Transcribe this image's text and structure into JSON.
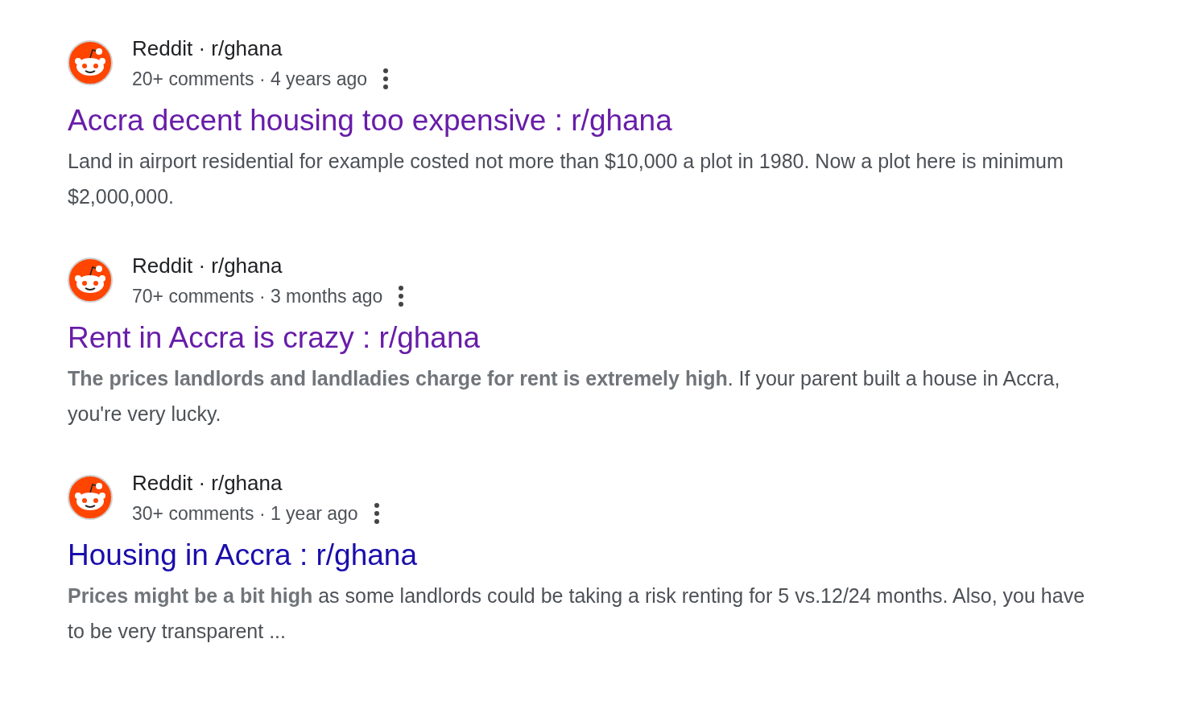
{
  "results": [
    {
      "source": "Reddit · r/ghana",
      "meta": "20+ comments · 4 years ago",
      "title": "Accra decent housing too expensive : r/ghana",
      "visited": true,
      "snippet": "Land in airport residential for example costed not more than $10,000 a plot in 1980. Now a plot here is minimum $2,000,000."
    },
    {
      "source": "Reddit · r/ghana",
      "meta": "70+ comments · 3 months ago",
      "title": "Rent in Accra is crazy : r/ghana",
      "visited": true,
      "snippet": "**The prices landlords and landladies charge for rent is extremely high**. If your parent built a house in Accra, you're very lucky."
    },
    {
      "source": "Reddit · r/ghana",
      "meta": "30+ comments · 1 year ago",
      "title": "Housing in Accra : r/ghana",
      "visited": false,
      "snippet": "**Prices might be a bit high** as some landlords could be taking a risk renting for 5 vs.12/24 months. Also, you have to be very transparent ..."
    }
  ]
}
